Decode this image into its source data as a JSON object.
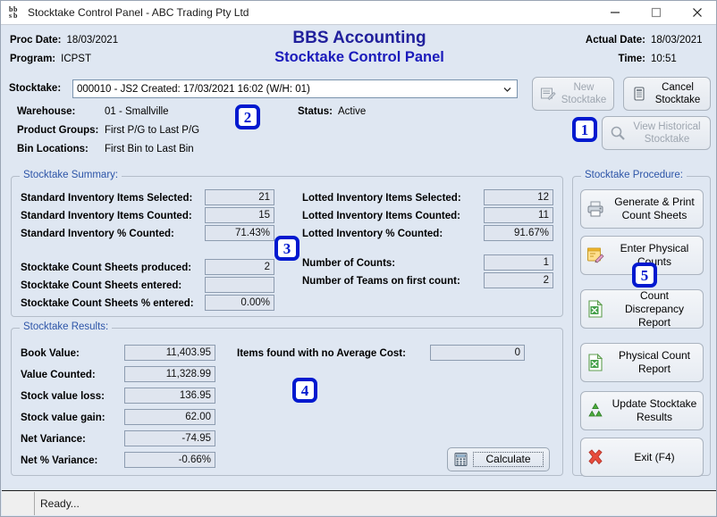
{
  "window": {
    "title": "Stocktake Control Panel - ABC Trading Pty Ltd",
    "minimize_label": "minimize",
    "maximize_label": "maximize",
    "close_label": "close"
  },
  "header": {
    "proc_date_label": "Proc Date:",
    "proc_date_value": "18/03/2021",
    "program_label": "Program:",
    "program_value": "ICPST",
    "brand_line1": "BBS Accounting",
    "brand_line2": "Stocktake Control Panel",
    "actual_date_label": "Actual Date:",
    "actual_date_value": "18/03/2021",
    "time_label": "Time:",
    "time_value": "10:51",
    "brand_color": "#21209c"
  },
  "selector": {
    "stocktake_label": "Stocktake:",
    "stocktake_value": "000010 - JS2 Created: 17/03/2021 16:02 (W/H: 01)",
    "warehouse_label": "Warehouse:",
    "warehouse_value": "01 - Smallville",
    "product_groups_label": "Product Groups:",
    "product_groups_value": "First P/G to Last P/G",
    "bin_locations_label": "Bin Locations:",
    "bin_locations_value": "First Bin to Last Bin",
    "status_label": "Status:",
    "status_value": "Active"
  },
  "top_buttons": {
    "new_line1": "New",
    "new_line2": "Stocktake",
    "cancel_line1": "Cancel",
    "cancel_line2": "Stocktake",
    "history_line1": "View Historical",
    "history_line2": "Stocktake"
  },
  "summary": {
    "title": "Stocktake Summary:",
    "left_fields": [
      {
        "label": "Standard Inventory Items Selected:",
        "value": "21"
      },
      {
        "label": "Standard Inventory Items Counted:",
        "value": "15"
      },
      {
        "label": "Standard Inventory % Counted:",
        "value": "71.43%"
      },
      {
        "label": "Stocktake Count Sheets produced:",
        "value": "2"
      },
      {
        "label": "Stocktake Count Sheets entered:",
        "value": ""
      },
      {
        "label": "Stocktake Count Sheets % entered:",
        "value": "0.00%"
      }
    ],
    "right_fields": [
      {
        "label": "Lotted Inventory Items Selected:",
        "value": "12"
      },
      {
        "label": "Lotted Inventory Items Counted:",
        "value": "11"
      },
      {
        "label": "Lotted Inventory % Counted:",
        "value": "91.67%"
      },
      {
        "label": "Number of Counts:",
        "value": "1"
      },
      {
        "label": "Number of Teams on first count:",
        "value": "2"
      }
    ]
  },
  "results": {
    "title": "Stocktake Results:",
    "fields": [
      {
        "label": "Book Value:",
        "value": "11,403.95"
      },
      {
        "label": "Value Counted:",
        "value": "11,328.99"
      },
      {
        "label": "Stock value loss:",
        "value": "136.95"
      },
      {
        "label": "Stock value gain:",
        "value": "62.00"
      },
      {
        "label": "Net Variance:",
        "value": "-74.95"
      },
      {
        "label": "Net % Variance:",
        "value": "-0.66%"
      }
    ],
    "no_avg_cost_label": "Items found with no Average Cost:",
    "no_avg_cost_value": "0",
    "calculate_label": "Calculate"
  },
  "procedure": {
    "title": "Stocktake Procedure:",
    "buttons": [
      {
        "line1": "Generate & Print",
        "line2": "Count Sheets",
        "icon": "printer-icon"
      },
      {
        "line1": "Enter Physical",
        "line2": "Counts",
        "icon": "note-pencil-icon"
      },
      {
        "line1": "Count Discrepancy",
        "line2": "Report",
        "icon": "spreadsheet-icon"
      },
      {
        "line1": "Physical Count",
        "line2": "Report",
        "icon": "spreadsheet-icon"
      },
      {
        "line1": "Update Stocktake",
        "line2": "Results",
        "icon": "recycle-icon"
      },
      {
        "line1": "Exit (F4)",
        "line2": "",
        "icon": "red-x-icon"
      }
    ]
  },
  "annotations": {
    "badge1": "1",
    "badge2": "2",
    "badge3": "3",
    "badge4": "4",
    "badge5": "5",
    "color": "#0019cf"
  },
  "statusbar": {
    "message": "Ready..."
  }
}
